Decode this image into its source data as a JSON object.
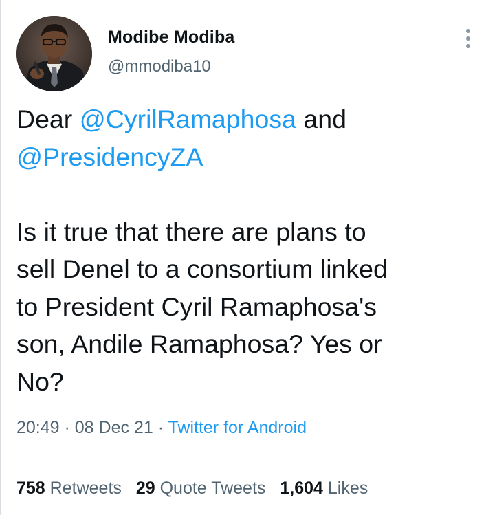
{
  "user": {
    "display_name": "Modibe Modiba",
    "handle": "@mmodiba10"
  },
  "tweet": {
    "line1_prefix": "Dear ",
    "mention1": "@CyrilRamaphosa",
    "line1_suffix": " and",
    "mention2": "@PresidencyZA",
    "body_lines": [
      "Is it true that there are plans to",
      "sell Denel to a consortium linked",
      "to President Cyril Ramaphosa's",
      "son, Andile Ramaphosa? Yes or",
      "No?"
    ]
  },
  "meta": {
    "time": "20:49",
    "separator": " · ",
    "date": "08 Dec 21",
    "source": "Twitter for Android"
  },
  "stats": {
    "retweets_count": "758",
    "retweets_label": "Retweets",
    "quotes_count": "29",
    "quotes_label": "Quote Tweets",
    "likes_count": "1,604",
    "likes_label": "Likes"
  },
  "colors": {
    "link": "#1d9bf0",
    "secondary_text": "#536471",
    "primary_text": "#0f1419"
  },
  "icons": {
    "more": "more-options-icon",
    "avatar": "profile-photo"
  }
}
